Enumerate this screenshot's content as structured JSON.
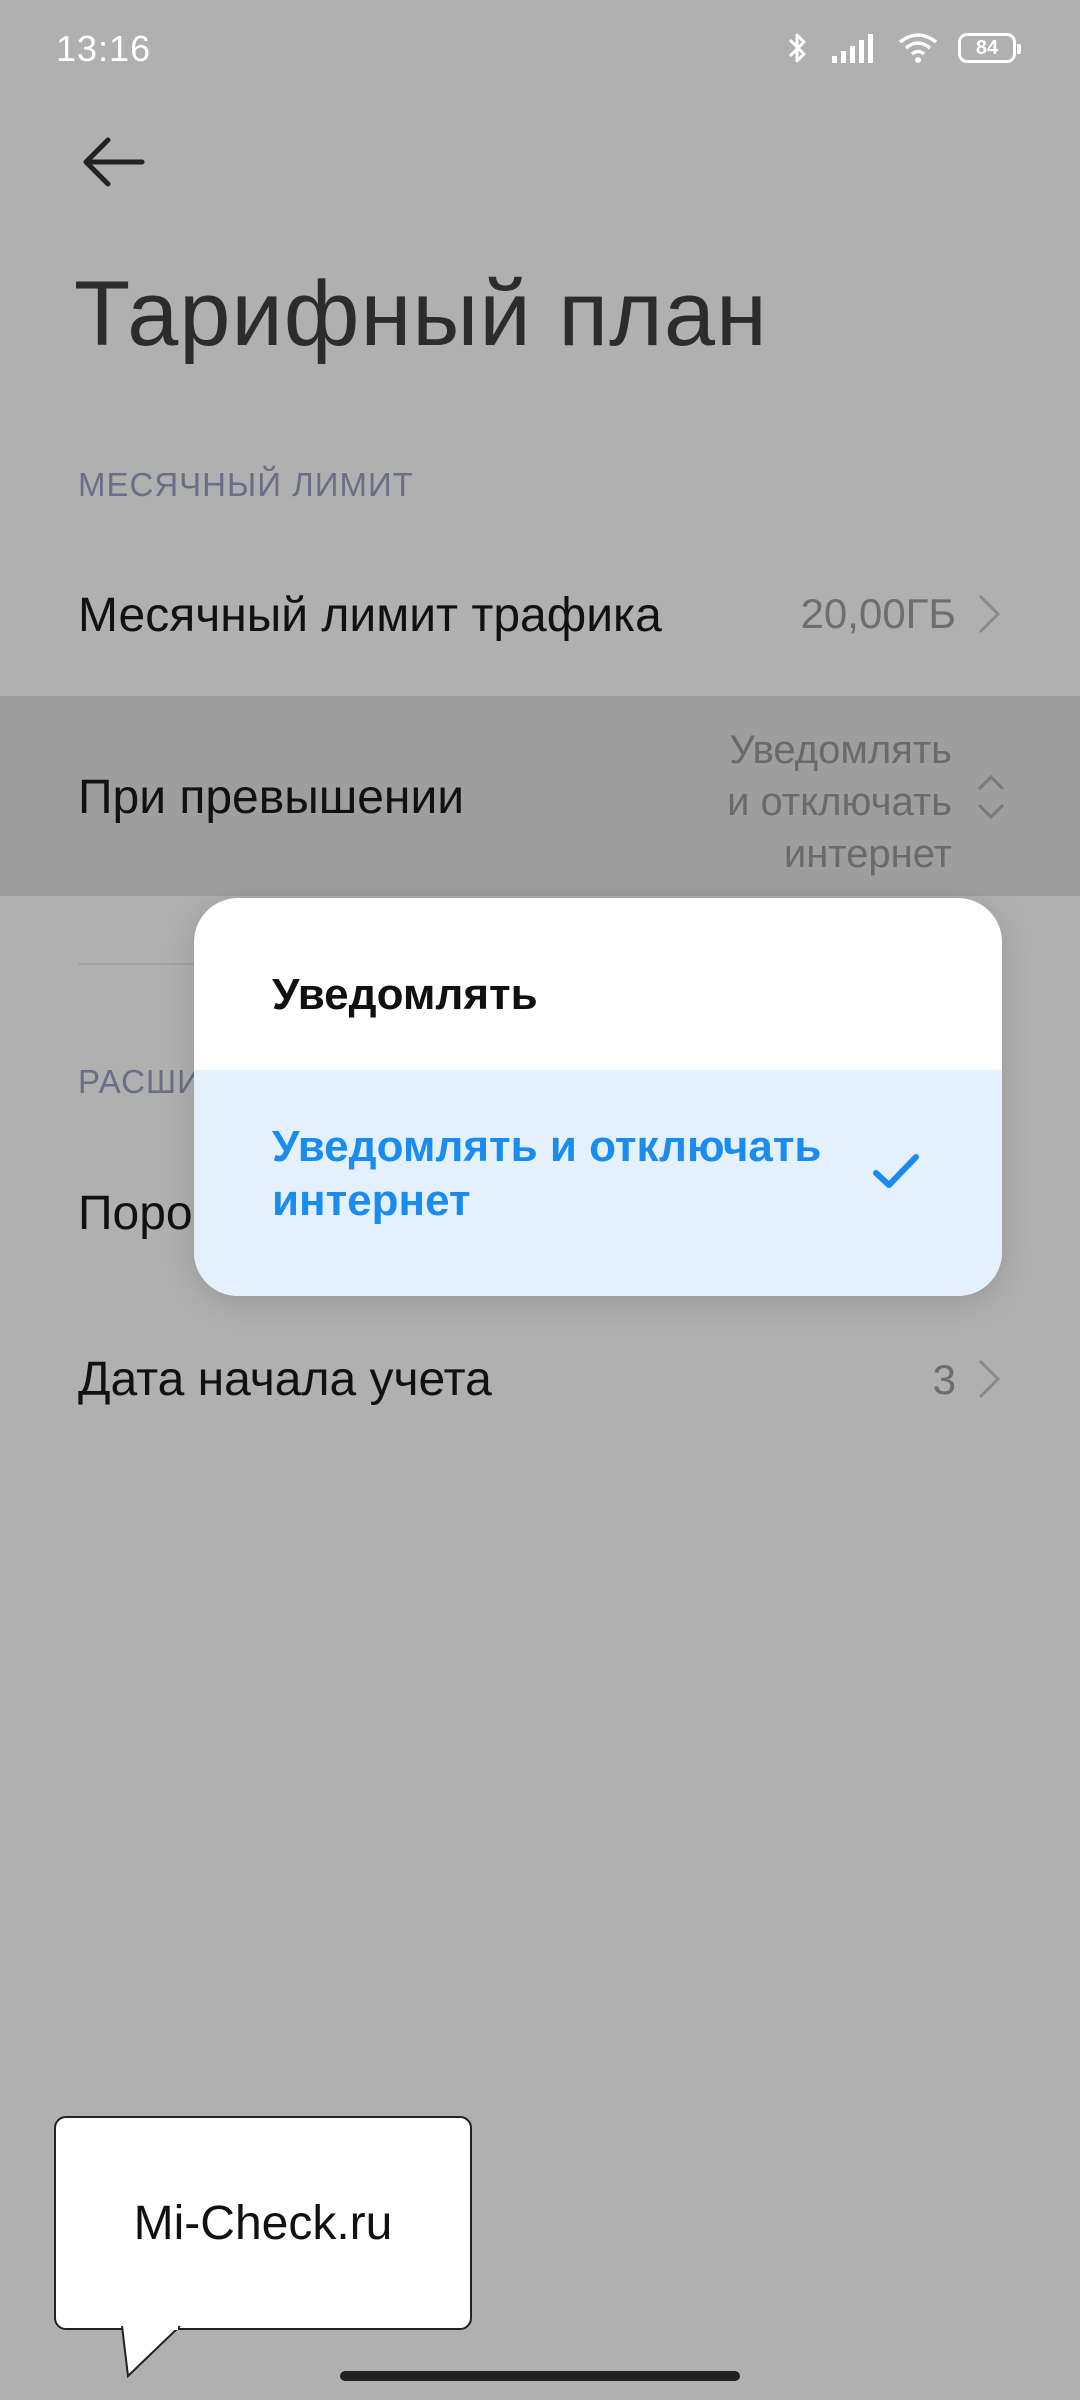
{
  "status_bar": {
    "time": "13:16",
    "battery": "84",
    "icons": [
      "bluetooth-icon",
      "signal-icon",
      "wifi-icon",
      "battery-icon"
    ]
  },
  "header": {
    "back_icon": "back-arrow-icon",
    "title": "Тарифный план"
  },
  "sections": {
    "monthly_limit_label": "МЕСЯЧНЫЙ ЛИМИТ",
    "advanced_label": "РАСШИ"
  },
  "rows": {
    "monthly_limit": {
      "label": "Месячный лимит трафика",
      "value": "20,00ГБ"
    },
    "on_exceed": {
      "label": "При превышении",
      "value_lines": [
        "Уведомлять",
        "и отключать",
        "интернет"
      ]
    },
    "threshold": {
      "label": "Поро"
    },
    "start_date": {
      "label": "Дата начала учета",
      "value": "3"
    }
  },
  "popup": {
    "options": [
      {
        "label": "Уведомлять",
        "selected": false
      },
      {
        "label": "Уведомлять и отключать интернет",
        "selected": true
      }
    ]
  },
  "watermark": {
    "text": "Mi-Check.ru"
  },
  "colors": {
    "overlay_bg": "#b0b0b0",
    "accent": "#1a8cf0",
    "selected_option_bg": "#e4f1fd"
  }
}
